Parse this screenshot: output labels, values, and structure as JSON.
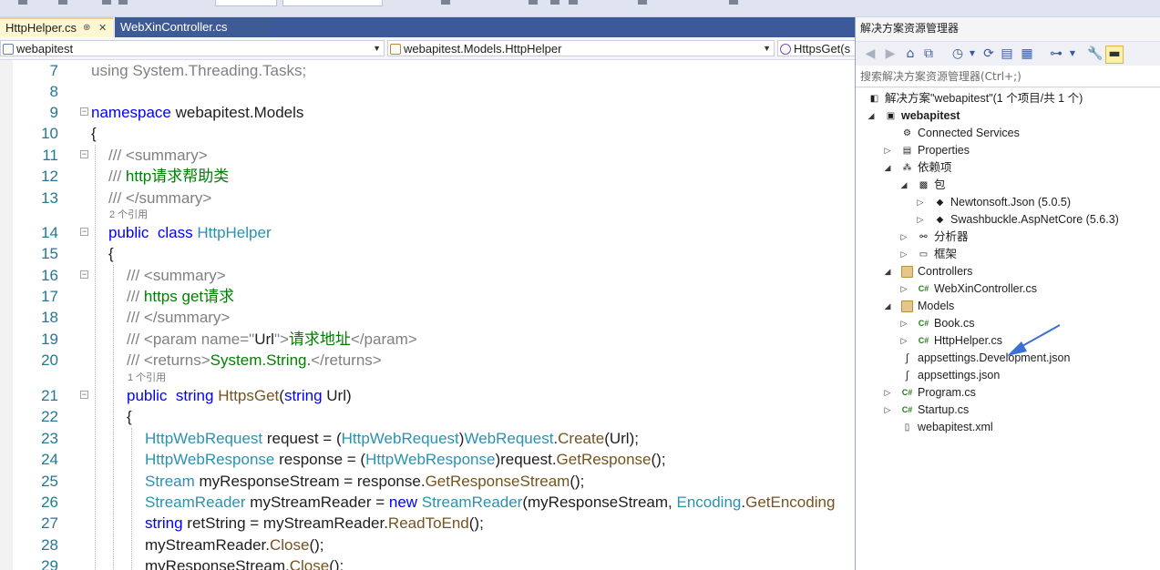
{
  "tabs": {
    "active": "HttpHelper.cs",
    "active_pin": "⊕",
    "active_close": "✕",
    "inactive": "WebXinController.cs"
  },
  "nav": {
    "project": "webapitest",
    "class": "webapitest.Models.HttpHelper",
    "member": "HttpsGet(s"
  },
  "code_lines": [
    {
      "n": "7",
      "parts": [
        {
          "c": "x",
          "t": "using System.Threading.Tasks;"
        }
      ]
    },
    {
      "n": "8",
      "parts": []
    },
    {
      "n": "9",
      "parts": [
        {
          "c": "k",
          "t": "namespace"
        },
        {
          "c": "",
          "t": " webapitest.Models"
        }
      ]
    },
    {
      "n": "10",
      "parts": [
        {
          "c": "",
          "t": "{"
        }
      ]
    },
    {
      "n": "11",
      "parts": [
        {
          "c": "x",
          "t": "/// <summary>"
        }
      ]
    },
    {
      "n": "12",
      "parts": [
        {
          "c": "x",
          "t": "/// "
        },
        {
          "c": "c",
          "t": "http请求帮助类"
        }
      ]
    },
    {
      "n": "13",
      "parts": [
        {
          "c": "x",
          "t": "/// </summary>"
        }
      ]
    },
    {
      "n": "14",
      "parts": [
        {
          "c": "k",
          "t": "public"
        },
        {
          "c": "",
          "t": "  "
        },
        {
          "c": "k",
          "t": "class"
        },
        {
          "c": "",
          "t": " "
        },
        {
          "c": "t",
          "t": "HttpHelper"
        }
      ]
    },
    {
      "n": "15",
      "parts": [
        {
          "c": "",
          "t": "{"
        }
      ]
    },
    {
      "n": "16",
      "parts": [
        {
          "c": "x",
          "t": "/// <summary>"
        }
      ]
    },
    {
      "n": "17",
      "parts": [
        {
          "c": "x",
          "t": "/// "
        },
        {
          "c": "c",
          "t": "https get请求"
        }
      ]
    },
    {
      "n": "18",
      "parts": [
        {
          "c": "x",
          "t": "/// </summary>"
        }
      ]
    },
    {
      "n": "19",
      "parts": [
        {
          "c": "x",
          "t": "/// <param name=\""
        },
        {
          "c": "",
          "t": "Url"
        },
        {
          "c": "x",
          "t": "\">"
        },
        {
          "c": "c",
          "t": "请求地址"
        },
        {
          "c": "x",
          "t": "</param>"
        }
      ]
    },
    {
      "n": "20",
      "parts": [
        {
          "c": "x",
          "t": "/// <returns>"
        },
        {
          "c": "c",
          "t": "System.String."
        },
        {
          "c": "x",
          "t": "</returns>"
        }
      ]
    },
    {
      "n": "21",
      "parts": [
        {
          "c": "k",
          "t": "public"
        },
        {
          "c": "",
          "t": "  "
        },
        {
          "c": "k",
          "t": "string"
        },
        {
          "c": "",
          "t": " "
        },
        {
          "c": "m",
          "t": "HttpsGet"
        },
        {
          "c": "",
          "t": "("
        },
        {
          "c": "k",
          "t": "string"
        },
        {
          "c": "",
          "t": " Url)"
        }
      ]
    },
    {
      "n": "22",
      "parts": [
        {
          "c": "",
          "t": "{"
        }
      ]
    },
    {
      "n": "23",
      "parts": [
        {
          "c": "t",
          "t": "HttpWebRequest"
        },
        {
          "c": "",
          "t": " request = ("
        },
        {
          "c": "t",
          "t": "HttpWebRequest"
        },
        {
          "c": "",
          "t": ")"
        },
        {
          "c": "t",
          "t": "WebRequest"
        },
        {
          "c": "",
          "t": "."
        },
        {
          "c": "m",
          "t": "Create"
        },
        {
          "c": "",
          "t": "(Url);"
        }
      ]
    },
    {
      "n": "24",
      "parts": [
        {
          "c": "t",
          "t": "HttpWebResponse"
        },
        {
          "c": "",
          "t": " response = ("
        },
        {
          "c": "t",
          "t": "HttpWebResponse"
        },
        {
          "c": "",
          "t": ")request."
        },
        {
          "c": "m",
          "t": "GetResponse"
        },
        {
          "c": "",
          "t": "();"
        }
      ]
    },
    {
      "n": "25",
      "parts": [
        {
          "c": "t",
          "t": "Stream"
        },
        {
          "c": "",
          "t": " myResponseStream = response."
        },
        {
          "c": "m",
          "t": "GetResponseStream"
        },
        {
          "c": "",
          "t": "();"
        }
      ]
    },
    {
      "n": "26",
      "parts": [
        {
          "c": "t",
          "t": "StreamReader"
        },
        {
          "c": "",
          "t": " myStreamReader = "
        },
        {
          "c": "k",
          "t": "new"
        },
        {
          "c": "",
          "t": " "
        },
        {
          "c": "t",
          "t": "StreamReader"
        },
        {
          "c": "",
          "t": "(myResponseStream, "
        },
        {
          "c": "t",
          "t": "Encoding"
        },
        {
          "c": "",
          "t": "."
        },
        {
          "c": "m",
          "t": "GetEncoding"
        }
      ]
    },
    {
      "n": "27",
      "parts": [
        {
          "c": "k",
          "t": "string"
        },
        {
          "c": "",
          "t": " retString = myStreamReader."
        },
        {
          "c": "m",
          "t": "ReadToEnd"
        },
        {
          "c": "",
          "t": "();"
        }
      ]
    },
    {
      "n": "28",
      "parts": [
        {
          "c": "",
          "t": "myStreamReader."
        },
        {
          "c": "m",
          "t": "Close"
        },
        {
          "c": "",
          "t": "();"
        }
      ]
    },
    {
      "n": "29",
      "parts": [
        {
          "c": "",
          "t": "myResponseStream."
        },
        {
          "c": "m",
          "t": "Close"
        },
        {
          "c": "",
          "t": "();"
        }
      ]
    }
  ],
  "codelens": {
    "class_refs": "2 个引用",
    "method_refs": "1 个引用"
  },
  "solution": {
    "title": "解决方案资源管理器",
    "search_placeholder": "搜索解决方案资源管理器(Ctrl+;)",
    "items": [
      {
        "label": "解决方案\"webapitest\"(1 个项目/共 1 个)",
        "icon": "solution-icon"
      },
      {
        "label": "webapitest",
        "icon": "project-icon"
      },
      {
        "label": "Connected Services",
        "icon": "connected-services-icon"
      },
      {
        "label": "Properties",
        "icon": "properties-icon"
      },
      {
        "label": "依赖项",
        "icon": "dependencies-icon"
      },
      {
        "label": "包",
        "icon": "packages-icon"
      },
      {
        "label": "Newtonsoft.Json (5.0.5)",
        "icon": "package-icon"
      },
      {
        "label": "Swashbuckle.AspNetCore (5.6.3)",
        "icon": "package-icon"
      },
      {
        "label": "分析器",
        "icon": "analyzers-icon"
      },
      {
        "label": "框架",
        "icon": "framework-icon"
      },
      {
        "label": "Controllers",
        "icon": "folder-icon"
      },
      {
        "label": "WebXinController.cs",
        "icon": "csharp-file-icon"
      },
      {
        "label": "Models",
        "icon": "folder-icon"
      },
      {
        "label": "Book.cs",
        "icon": "csharp-file-icon"
      },
      {
        "label": "HttpHelper.cs",
        "icon": "csharp-file-icon"
      },
      {
        "label": "appsettings.Development.json",
        "icon": "json-file-icon"
      },
      {
        "label": "appsettings.json",
        "icon": "json-file-icon"
      },
      {
        "label": "Program.cs",
        "icon": "csharp-file-icon"
      },
      {
        "label": "Startup.cs",
        "icon": "csharp-file-icon"
      },
      {
        "label": "webapitest.xml",
        "icon": "xml-file-icon"
      }
    ]
  },
  "colors": {
    "keyword": "#0000ff",
    "type": "#2b91af",
    "comment_text": "#008000",
    "doc_tag": "#808080",
    "method": "#74531f",
    "line_number": "#237893",
    "annotation_arrow": "#3a6fd8"
  }
}
